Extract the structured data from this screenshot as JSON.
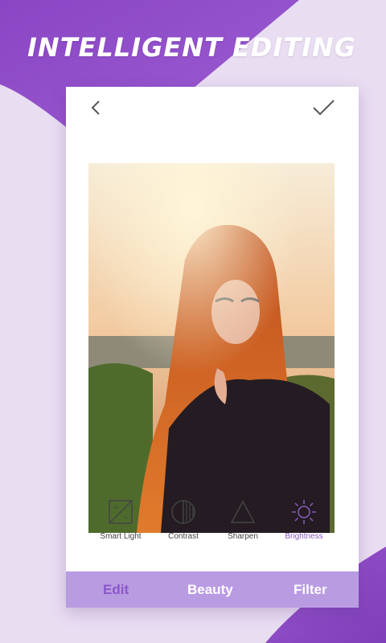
{
  "headline": "INTELLIGENT EDITING",
  "colors": {
    "background": "#e9ddf2",
    "accent_purple": "#8a56c8",
    "tabbar": "#b99be2",
    "tab_text": "#ffffff"
  },
  "editor": {
    "back_icon": "chevron-left-icon",
    "done_icon": "checkmark-icon",
    "photo": "portrait of a woman with long red hair wearing glasses and a black leather jacket at sunset"
  },
  "tools": [
    {
      "label": "Smart Light",
      "icon": "smart-light-icon"
    },
    {
      "label": "Contrast",
      "icon": "contrast-icon"
    },
    {
      "label": "Sharpen",
      "icon": "sharpen-icon"
    },
    {
      "label": "Brightness",
      "icon": "brightness-icon",
      "active": true
    }
  ],
  "tabs": [
    {
      "label": "Edit",
      "active": true
    },
    {
      "label": "Beauty",
      "active": false
    },
    {
      "label": "Filter",
      "active": false
    }
  ]
}
